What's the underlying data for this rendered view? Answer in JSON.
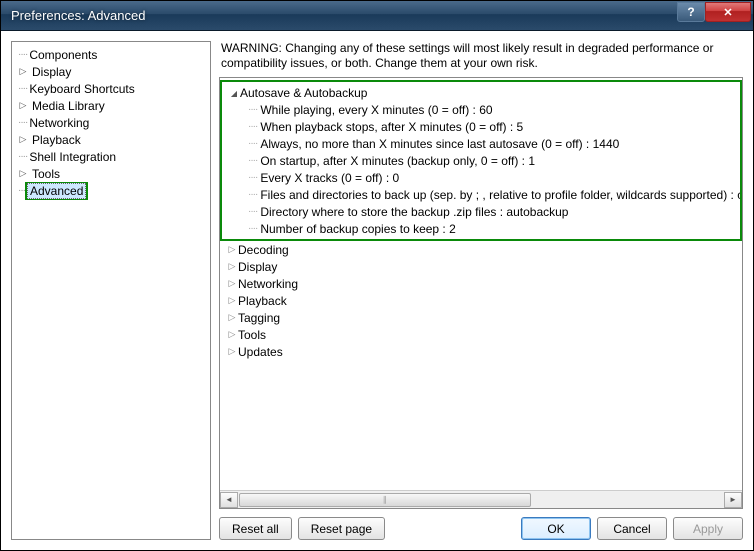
{
  "window": {
    "title": "Preferences: Advanced"
  },
  "sidebar": {
    "items": [
      {
        "label": "Components",
        "expandable": false
      },
      {
        "label": "Display",
        "expandable": true
      },
      {
        "label": "Keyboard Shortcuts",
        "expandable": false
      },
      {
        "label": "Media Library",
        "expandable": true
      },
      {
        "label": "Networking",
        "expandable": false
      },
      {
        "label": "Playback",
        "expandable": true
      },
      {
        "label": "Shell Integration",
        "expandable": false
      },
      {
        "label": "Tools",
        "expandable": true
      },
      {
        "label": "Advanced",
        "expandable": false,
        "selected": true
      }
    ]
  },
  "warning_text": "WARNING: Changing any of these settings will most likely result in degraded performance or compatibility issues, or both. Change them at your own risk.",
  "settings": {
    "expanded_group": {
      "label": "Autosave & Autobackup",
      "items": [
        "While playing, every X minutes (0 = off) : 60",
        "When playback stops, after X minutes (0 = off) : 5",
        "Always, no more than X minutes since last autosave (0 = off) : 1440",
        "On startup, after X minutes (backup only, 0 = off) : 1",
        "Every X tracks (0 = off) : 0",
        "Files and directories to back up (sep. by ; , relative to profile folder, wildcards supported) : con",
        "Directory where to store the backup .zip files : autobackup",
        "Number of backup copies to keep : 2"
      ]
    },
    "collapsed_groups": [
      "Decoding",
      "Display",
      "Networking",
      "Playback",
      "Tagging",
      "Tools",
      "Updates"
    ]
  },
  "buttons": {
    "reset_all": "Reset all",
    "reset_page": "Reset page",
    "ok": "OK",
    "cancel": "Cancel",
    "apply": "Apply"
  }
}
